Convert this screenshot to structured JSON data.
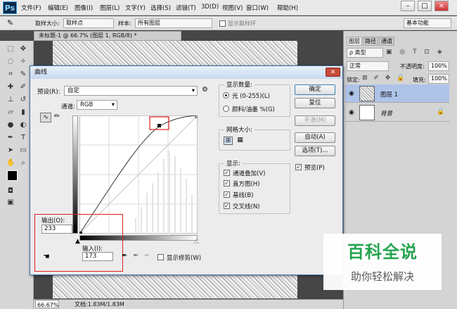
{
  "app": {
    "logo": "Ps",
    "menu": [
      "文件(F)",
      "编辑(E)",
      "图像(I)",
      "图层(L)",
      "文字(Y)",
      "选择(S)",
      "滤镜(T)",
      "3D(D)",
      "视图(V)",
      "窗口(W)",
      "帮助(H)"
    ]
  },
  "options": {
    "sample_size_label": "取样大小:",
    "sample_size": "取样点",
    "sample_label": "样本:",
    "sample": "所有图层",
    "show_ring": "显示取样环",
    "workspace": "基本功能"
  },
  "document": {
    "tab": "未标题-1 @ 66.7% (图层 1, RGB/8) *",
    "zoom": "66.67%",
    "docsize": "文档:1.83M/1.83M"
  },
  "panels": {
    "tabs": [
      "图层",
      "路径",
      "通道"
    ],
    "kind": "ρ 类型",
    "blend": "正常",
    "opacity_label": "不透明度:",
    "opacity": "100%",
    "lock_label": "锁定:",
    "fill_label": "填充:",
    "fill": "100%",
    "layers": [
      {
        "name": "图层 1"
      },
      {
        "name": "背景"
      }
    ]
  },
  "curves": {
    "title": "曲线",
    "preset_label": "预设(R):",
    "preset": "自定",
    "channel_label": "通道:",
    "channel": "RGB",
    "output_label": "输出(O):",
    "output": "233",
    "input_label": "输入(I):",
    "input": "173",
    "show_clipping": "显示修剪(W)",
    "buttons": {
      "ok": "确定",
      "reset": "复位",
      "smooth": "平滑(M)",
      "auto": "自动(A)",
      "options": "选项(T)..."
    },
    "preview": "预览(P)",
    "amount_title": "显示数量:",
    "light": "光 (0-255)(L)",
    "pigment": "颜料/油墨 %(G)",
    "grid_title": "网格大小:",
    "show_title": "显示:",
    "show_items": [
      "通道叠加(V)",
      "直方图(H)",
      "基线(B)",
      "交叉线(N)"
    ]
  },
  "watermark": {
    "title": "百科全说",
    "subtitle": "助你轻松解决"
  }
}
